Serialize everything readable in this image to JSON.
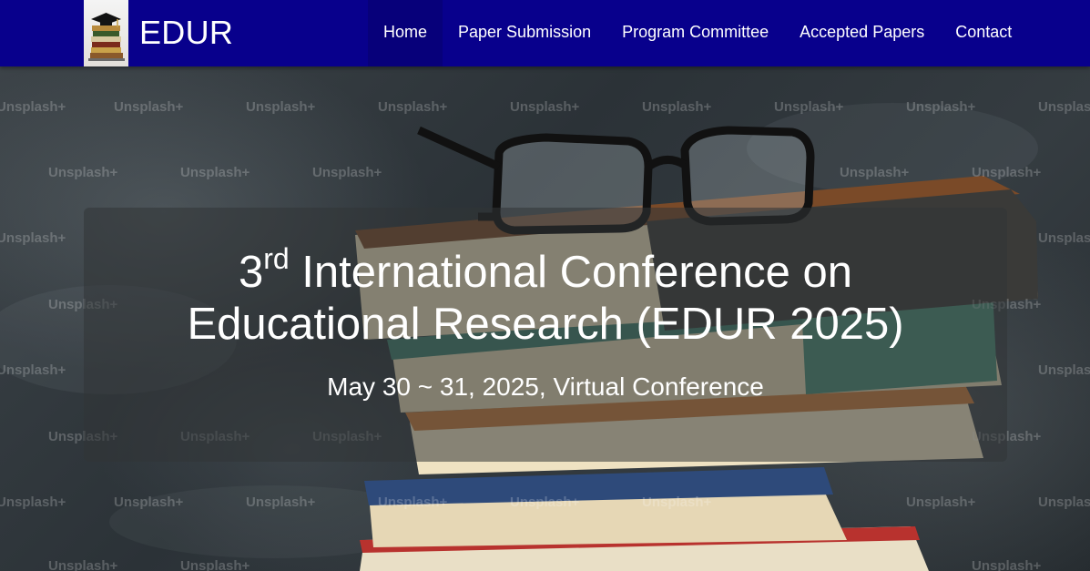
{
  "navbar": {
    "logo_icon": "graduation-cap-books-logo",
    "brand": "EDUR",
    "items": [
      {
        "label": "Home",
        "active": true
      },
      {
        "label": "Paper Submission",
        "active": false
      },
      {
        "label": "Program Committee",
        "active": false
      },
      {
        "label": "Accepted Papers",
        "active": false
      },
      {
        "label": "Contact",
        "active": false
      }
    ]
  },
  "hero": {
    "title_prefix": "3",
    "title_superscript": "rd",
    "title_line1": " International Conference on",
    "title_line2": "Educational Research (EDUR 2025)",
    "date_line": "May 30 ~ 31, 2025, Virtual Conference",
    "watermark_text": "Unsplash+"
  },
  "colors": {
    "navbar_bg": "#08008c",
    "nav_active_bg": "#07007a",
    "text": "#ffffff"
  }
}
